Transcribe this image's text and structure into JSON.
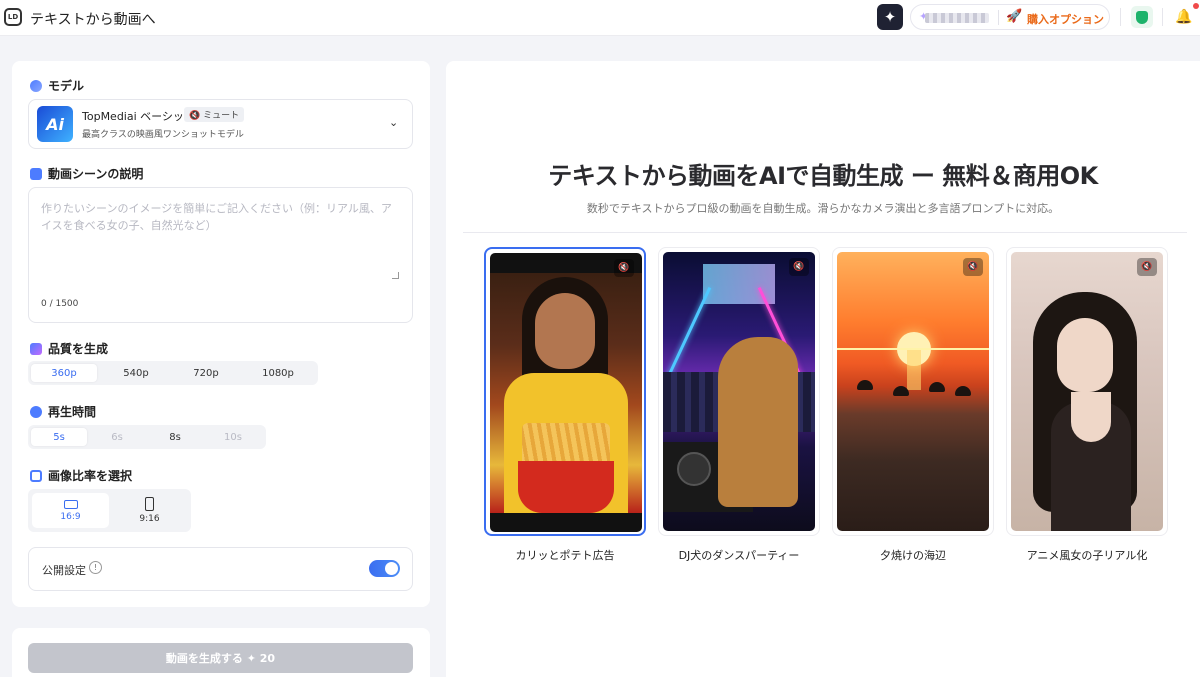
{
  "header": {
    "logo_text": "LD",
    "title": "テキストから動画へ",
    "purchase_label": "購入オプション"
  },
  "left": {
    "model_section": "モデル",
    "model": {
      "logo_text": "Ai",
      "name": "TopMediai ベーシック",
      "mute_badge": "🔇 ミュート",
      "description": "最高クラスの映画風ワンショットモデル"
    },
    "description_section": "動画シーンの説明",
    "description_placeholder": "作りたいシーンのイメージを簡単にご記入ください（例：リアル風、アイスを食べる女の子、自然光など）",
    "char_count": "0 / 1500",
    "quality_section": "品質を生成",
    "quality_options": [
      "360p",
      "540p",
      "720p",
      "1080p"
    ],
    "duration_section": "再生時間",
    "duration_options": [
      "5s",
      "6s",
      "8s",
      "10s"
    ],
    "ratio_section": "画像比率を選択",
    "ratio_options": [
      "16:9",
      "9:16"
    ],
    "public_label": "公開設定",
    "generate_button": "動画を生成する ✦ 20"
  },
  "right": {
    "hero_title": "テキストから動画をAIで自動生成 ー 無料＆商用OK",
    "hero_subtitle": "数秒でテキストからプロ級の動画を自動生成。滑らかなカメラ演出と多言語プロンプトに対応。",
    "samples": [
      {
        "caption": "カリッとポテト広告"
      },
      {
        "caption": "DJ犬のダンスパーティー"
      },
      {
        "caption": "夕焼けの海辺"
      },
      {
        "caption": "アニメ風女の子リアル化"
      }
    ]
  },
  "colors": {
    "accent": "#3a6df0",
    "purchase": "#ea6a1a",
    "generate_disabled": "#c3c5cc"
  }
}
